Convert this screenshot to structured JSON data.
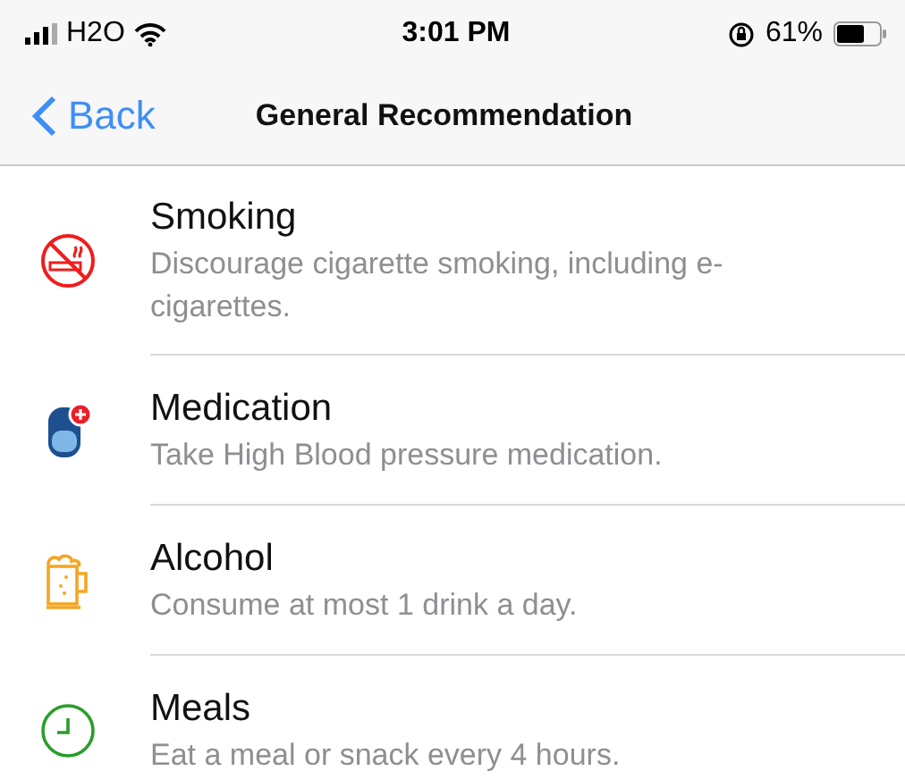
{
  "status_bar": {
    "carrier": "H2O",
    "time": "3:01 PM",
    "battery": "61%"
  },
  "nav": {
    "back": "Back",
    "title": "General Recommendation"
  },
  "items": [
    {
      "title": "Smoking",
      "description": "Discourage cigarette smoking, including e-cigarettes."
    },
    {
      "title": "Medication",
      "description": "Take High Blood pressure medication."
    },
    {
      "title": "Alcohol",
      "description": "Consume at most 1 drink a day."
    },
    {
      "title": "Meals",
      "description": "Eat a meal or snack every 4 hours."
    }
  ]
}
